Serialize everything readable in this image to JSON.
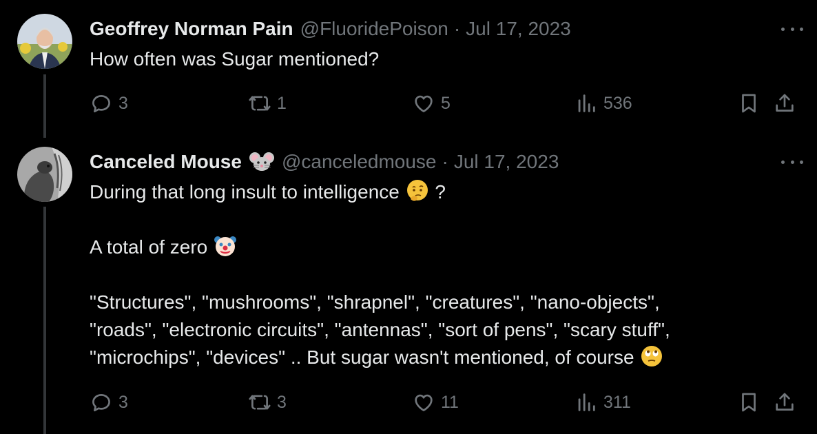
{
  "tweets": [
    {
      "author_name": "Geoffrey Norman Pain",
      "handle": "@FluoridePoison",
      "separator": "·",
      "date": "Jul 17, 2023",
      "lines": [
        "How often was Sugar mentioned?"
      ],
      "replies": "3",
      "retweets": "1",
      "likes": "5",
      "views": "536"
    },
    {
      "author_name": "Canceled Mouse",
      "name_emoji": "mouse-face-emoji",
      "handle": "@canceledmouse",
      "separator": "·",
      "date": "Jul 17, 2023",
      "line1": "During that long insult to intelligence",
      "line1_suffix": "?",
      "line3": "A total of zero",
      "line5": "\"Structures\", \"mushrooms\", \"shrapnel\", \"creatures\", \"nano-objects\",",
      "line6": "\"roads\", \"electronic circuits\", \"antennas\", \"sort of pens\", \"scary stuff\",",
      "line7": "\"microchips\", \"devices\" .. But sugar wasn't mentioned, of course",
      "replies": "3",
      "retweets": "3",
      "likes": "11",
      "views": "311"
    }
  ],
  "icons": [
    "reply-icon",
    "retweet-icon",
    "like-icon",
    "views-icon",
    "bookmark-icon",
    "share-icon",
    "more-icon"
  ],
  "colors": {
    "background": "#000000",
    "text": "#e7e9ea",
    "muted": "#71767b",
    "thread_line": "#333639"
  }
}
